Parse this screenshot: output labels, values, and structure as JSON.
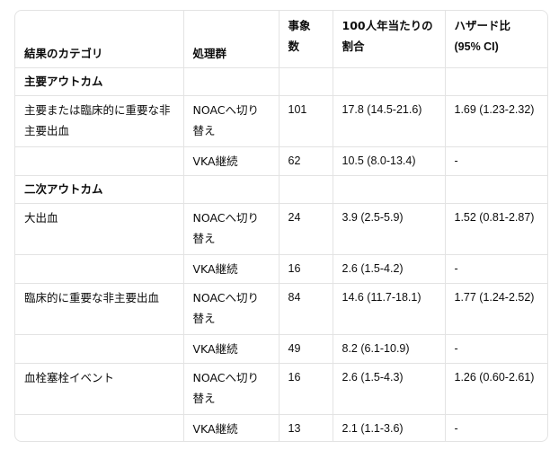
{
  "table": {
    "headers": [
      "結果のカテゴリ",
      "処理群",
      "事象数",
      "100人年当たりの割合",
      "ハザード比 (95% CI)"
    ],
    "header_lines": {
      "col3": [
        "事象",
        "数"
      ],
      "col4": [
        "100人年当たりの",
        "割合"
      ],
      "col5": [
        "ハザード比",
        "(95% CI)"
      ]
    },
    "sections": [
      {
        "title": "主要アウトカム",
        "rows": [
          {
            "category": "主要または臨床的に重要な非主要出血",
            "group": "NOACへ切り替え",
            "events": "101",
            "rate": "17.8 (14.5-21.6)",
            "hr": "1.69 (1.23-2.32)"
          },
          {
            "category": "",
            "group": "VKA継続",
            "events": "62",
            "rate": "10.5 (8.0-13.4)",
            "hr": "-"
          }
        ]
      },
      {
        "title": "二次アウトカム",
        "rows": [
          {
            "category": "大出血",
            "group": "NOACへ切り替え",
            "events": "24",
            "rate": "3.9 (2.5-5.9)",
            "hr": "1.52 (0.81-2.87)"
          },
          {
            "category": "",
            "group": "VKA継続",
            "events": "16",
            "rate": "2.6 (1.5-4.2)",
            "hr": "-"
          },
          {
            "category": "臨床的に重要な非主要出血",
            "group": "NOACへ切り替え",
            "events": "84",
            "rate": "14.6 (11.7-18.1)",
            "hr": "1.77 (1.24-2.52)"
          },
          {
            "category": "",
            "group": "VKA継続",
            "events": "49",
            "rate": "8.2 (6.1-10.9)",
            "hr": "-"
          },
          {
            "category": "血栓塞栓イベント",
            "group": "NOACへ切り替え",
            "events": "16",
            "rate": "2.6 (1.5-4.3)",
            "hr": "1.26 (0.60-2.61)"
          },
          {
            "category": "",
            "group": "VKA継続",
            "events": "13",
            "rate": "2.1 (1.1-3.6)",
            "hr": "-"
          }
        ]
      }
    ]
  }
}
